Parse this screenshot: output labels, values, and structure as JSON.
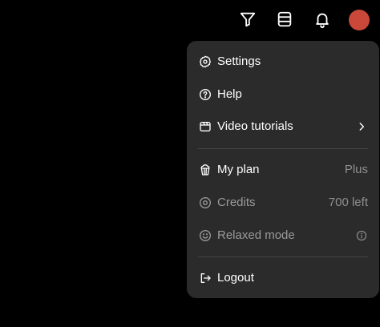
{
  "colors": {
    "background": "#000000",
    "menu_background": "#2b2b2b",
    "avatar": "#c9483a",
    "text_primary": "#ffffff",
    "text_muted": "#9a9a9a"
  },
  "topbar": {
    "icons": [
      "filter-icon",
      "stack-icon",
      "bell-icon"
    ],
    "avatar": "avatar"
  },
  "menu": {
    "settings": {
      "label": "Settings",
      "icon": "gear-icon"
    },
    "help": {
      "label": "Help",
      "icon": "help-circle-icon"
    },
    "video_tutorials": {
      "label": "Video tutorials",
      "icon": "video-icon",
      "trailing_icon": "chevron-right-icon"
    },
    "my_plan": {
      "label": "My plan",
      "icon": "popcorn-icon",
      "value": "Plus"
    },
    "credits": {
      "label": "Credits",
      "icon": "credits-icon",
      "value": "700 left"
    },
    "relaxed_mode": {
      "label": "Relaxed mode",
      "icon": "smile-icon",
      "trailing_icon": "info-icon"
    },
    "logout": {
      "label": "Logout",
      "icon": "logout-icon"
    }
  }
}
